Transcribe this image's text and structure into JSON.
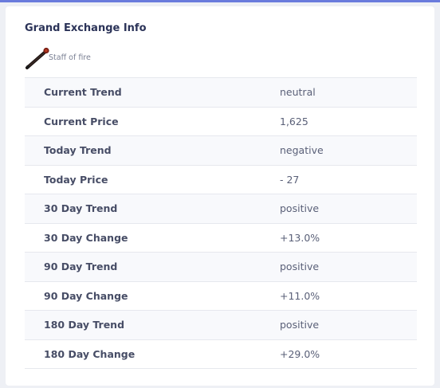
{
  "card": {
    "title": "Grand Exchange Info",
    "item": {
      "name": "Staff of fire",
      "icon": "staff-of-fire-icon"
    }
  },
  "rows": [
    {
      "label": "Current Trend",
      "value": "neutral"
    },
    {
      "label": "Current Price",
      "value": "1,625"
    },
    {
      "label": "Today Trend",
      "value": "negative"
    },
    {
      "label": "Today Price",
      "value": "- 27"
    },
    {
      "label": "30 Day Trend",
      "value": "positive"
    },
    {
      "label": "30 Day Change",
      "value": "+13.0%"
    },
    {
      "label": "90 Day Trend",
      "value": "positive"
    },
    {
      "label": "90 Day Change",
      "value": "+11.0%"
    },
    {
      "label": "180 Day Trend",
      "value": "positive"
    },
    {
      "label": "180 Day Change",
      "value": "+29.0%"
    }
  ],
  "colors": {
    "accent_bar": "#6a7bdc",
    "title": "#2b3358",
    "label": "#474d66",
    "value": "#5a6078"
  }
}
